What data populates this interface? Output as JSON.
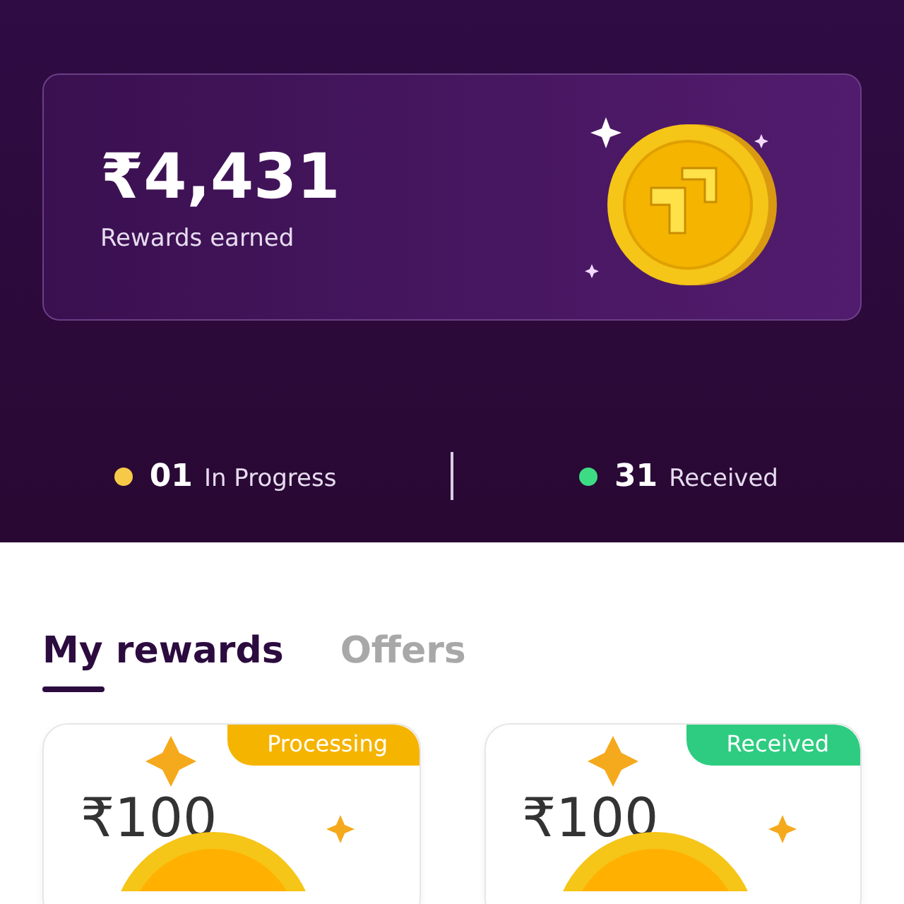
{
  "summary": {
    "amount": "₹4,431",
    "label": "Rewards earned"
  },
  "stats": [
    {
      "count": "01",
      "label": "In Progress",
      "color": "#f7c948"
    },
    {
      "count": "31",
      "label": "Received",
      "color": "#3ddc84"
    }
  ],
  "tabs": [
    {
      "label": "My rewards",
      "selected": true
    },
    {
      "label": "Offers",
      "selected": false
    }
  ],
  "rewards": [
    {
      "amount": "₹100",
      "status": "Processing",
      "color": "#f5b400"
    },
    {
      "amount": "₹100",
      "status": "Received",
      "color": "#2ecc80"
    }
  ]
}
